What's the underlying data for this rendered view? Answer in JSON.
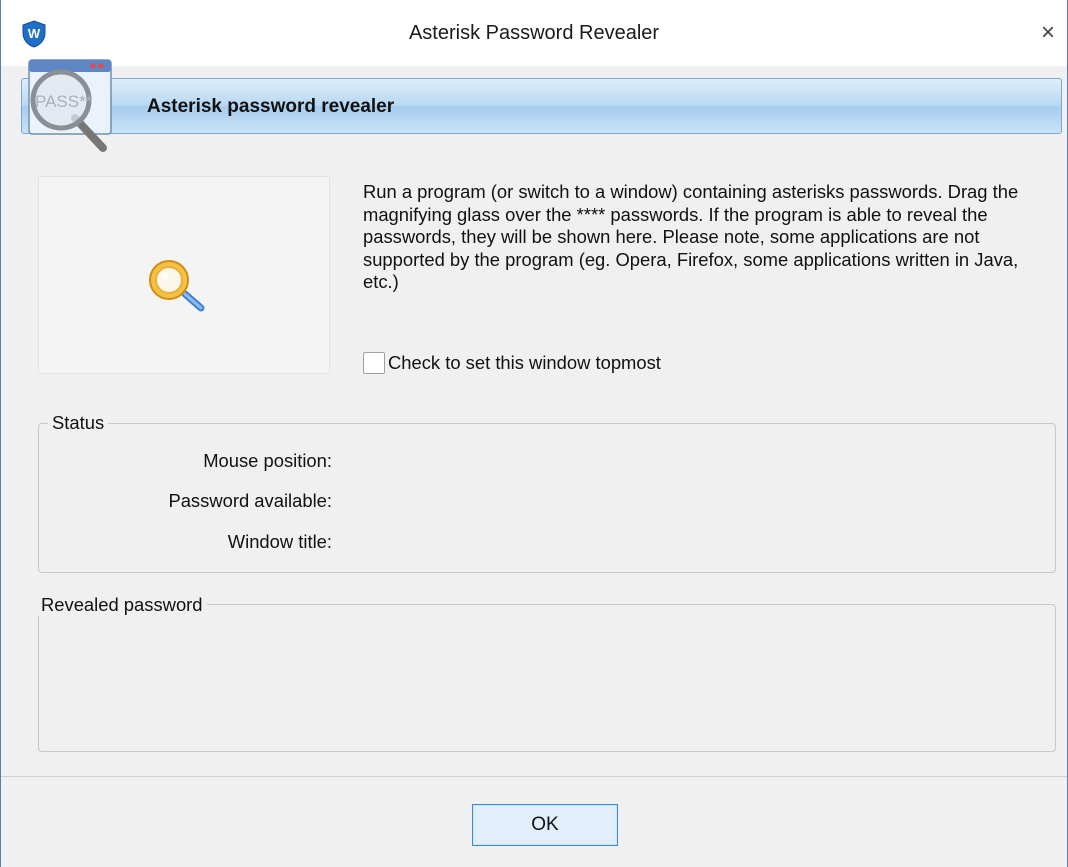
{
  "window": {
    "title": "Asterisk Password Revealer",
    "close_glyph": "×"
  },
  "banner": {
    "title": "Asterisk password revealer",
    "icon_text": "PASS**",
    "icon": "magnifier-pass-icon"
  },
  "main": {
    "description": "Run a program (or switch to a window) containing asterisks passwords. Drag the magnifying glass over the **** passwords. If the program is able to reveal the passwords, they will be shown here. Please note, some applications are not supported by the program (eg. Opera, Firefox, some applications written in Java, etc.)",
    "topmost_label": "Check to set this window topmost",
    "topmost_checked": false,
    "drag_icon": "magnifying-glass-icon"
  },
  "status": {
    "legend": "Status",
    "mouse_position_label": "Mouse position:",
    "mouse_position_value": "",
    "password_available_label": "Password available:",
    "password_available_value": "",
    "window_title_label": "Window title:",
    "window_title_value": ""
  },
  "revealed": {
    "legend": "Revealed password",
    "value": ""
  },
  "footer": {
    "ok_label": "OK"
  },
  "colors": {
    "accent": "#3c8ad6",
    "banner_gradient_top": "#dfeefa",
    "banner_gradient_bottom": "#a6cdee",
    "window_bg": "#f0f0f0"
  }
}
